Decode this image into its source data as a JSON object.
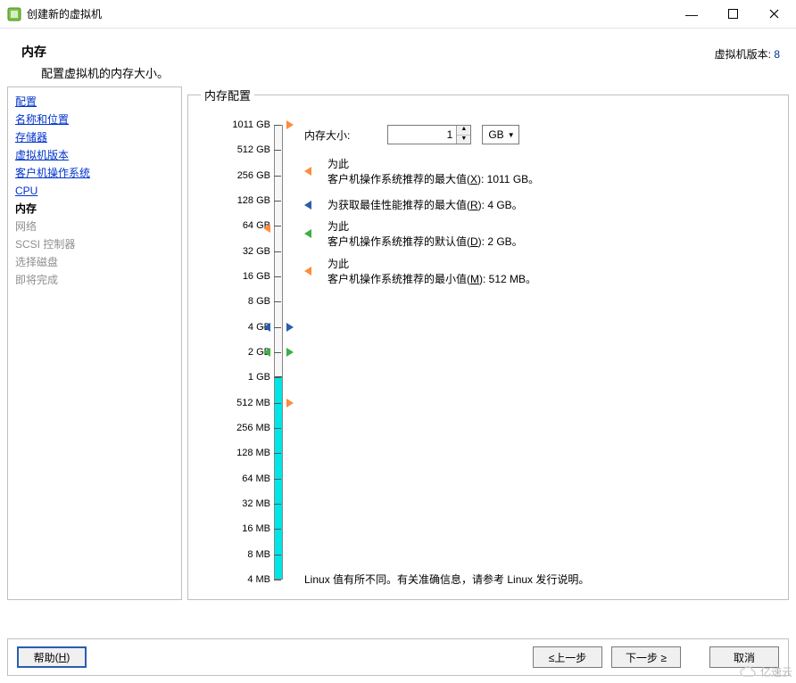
{
  "window": {
    "title": "创建新的虚拟机",
    "minimize_aria": "Minimize",
    "maximize_aria": "Maximize",
    "close_aria": "Close"
  },
  "header": {
    "title": "内存",
    "subtitle": "配置虚拟机的内存大小。",
    "version_label": "虚拟机版本:",
    "version_value": "8"
  },
  "sidebar": {
    "steps": [
      {
        "label": "配置",
        "state": "link"
      },
      {
        "label": "名称和位置",
        "state": "link"
      },
      {
        "label": "存储器",
        "state": "link"
      },
      {
        "label": "虚拟机版本",
        "state": "link"
      },
      {
        "label": "客户机操作系统",
        "state": "link"
      },
      {
        "label": "CPU",
        "state": "link"
      },
      {
        "label": "内存",
        "state": "current"
      },
      {
        "label": "网络",
        "state": "disabled"
      },
      {
        "label": "SCSI 控制器",
        "state": "disabled"
      },
      {
        "label": "选择磁盘",
        "state": "disabled"
      },
      {
        "label": "即将完成",
        "state": "disabled"
      }
    ]
  },
  "memory_panel": {
    "legend": "内存配置",
    "size_label": "内存大小:",
    "size_value": "1",
    "unit_value": "GB",
    "slider": {
      "ticks": [
        "1011 GB",
        "512 GB",
        "256 GB",
        "128 GB",
        "64 GB",
        "32 GB",
        "16 GB",
        "8 GB",
        "4 GB",
        "2 GB",
        "1 GB",
        "512 MB",
        "256 MB",
        "128 MB",
        "64 MB",
        "32 MB",
        "16 MB",
        "8 MB",
        "4 MB"
      ],
      "current_index": 10,
      "markers": [
        {
          "pos_index": 0,
          "side": "right",
          "color": "#ff8b3d",
          "name": "max-supported-marker"
        },
        {
          "pos_index": 4.1,
          "side": "left",
          "color": "#ff8b3d",
          "name": "max-os-marker"
        },
        {
          "pos_index": 8,
          "side": "left",
          "color": "#2a5db0",
          "name": "best-perf-marker"
        },
        {
          "pos_index": 9,
          "side": "left",
          "color": "#3cb043",
          "name": "default-marker"
        },
        {
          "pos_index": 8,
          "side": "right",
          "color": "#2a5db0",
          "name": "best-perf-marker-r"
        },
        {
          "pos_index": 9,
          "side": "right",
          "color": "#3cb043",
          "name": "default-marker-r"
        },
        {
          "pos_index": 11,
          "side": "right",
          "color": "#ff8b3d",
          "name": "min-marker"
        }
      ]
    },
    "recommendations": [
      {
        "color": "#ff8b3d",
        "line1": "为此",
        "line2_pre": "客户机操作系统推荐的最大值",
        "hotkey": "X",
        "value": "1011 GB"
      },
      {
        "color": "#2a5db0",
        "line1": "",
        "line2_pre": "为获取最佳性能推荐的最大值",
        "hotkey": "R",
        "value": "4 GB"
      },
      {
        "color": "#3cb043",
        "line1": "为此",
        "line2_pre": "客户机操作系统推荐的默认值",
        "hotkey": "D",
        "value": "2 GB"
      },
      {
        "color": "#ff8b3d",
        "line1": "为此",
        "line2_pre": "客户机操作系统推荐的最小值",
        "hotkey": "M",
        "value": "512 MB"
      }
    ],
    "footnote": "Linux 值有所不同。有关准确信息，请参考 Linux 发行说明。"
  },
  "footer": {
    "help": "帮助",
    "help_hotkey": "H",
    "back": "≤上一步",
    "next": "下一步 ≥",
    "cancel": "取消"
  },
  "watermark": "亿速云"
}
